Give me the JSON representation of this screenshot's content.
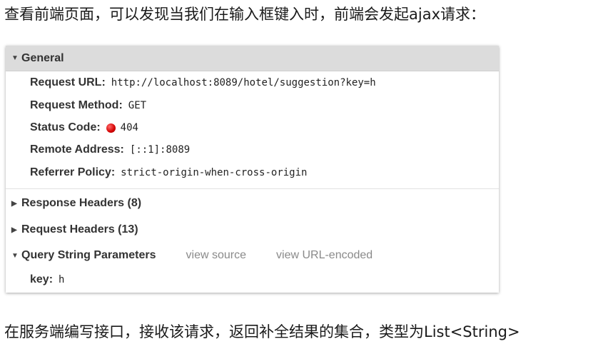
{
  "intro_text": "查看前端页面，可以发现当我们在输入框键入时，前端会发起ajax请求：",
  "outro_text": "在服务端编写接口，接收该请求，返回补全结果的集合，类型为List<String>",
  "general": {
    "title": "General",
    "rows": [
      {
        "key": "Request URL:",
        "value": "http://localhost:8089/hotel/suggestion?key=h"
      },
      {
        "key": "Request Method:",
        "value": "GET"
      },
      {
        "key": "Status Code:",
        "value": "404"
      },
      {
        "key": "Remote Address:",
        "value": "[::1]:8089"
      },
      {
        "key": "Referrer Policy:",
        "value": "strict-origin-when-cross-origin"
      }
    ],
    "status_color": "#d40000"
  },
  "sections": {
    "response_headers": "Response Headers (8)",
    "request_headers": "Request Headers (13)",
    "query_params": "Query String Parameters",
    "view_source": "view source",
    "view_url_encoded": "view URL-encoded"
  },
  "query": {
    "key": "key:",
    "value": "h"
  },
  "icons": {
    "expanded": "triangle-down-icon",
    "collapsed": "triangle-right-icon",
    "status": "status-dot-icon"
  }
}
